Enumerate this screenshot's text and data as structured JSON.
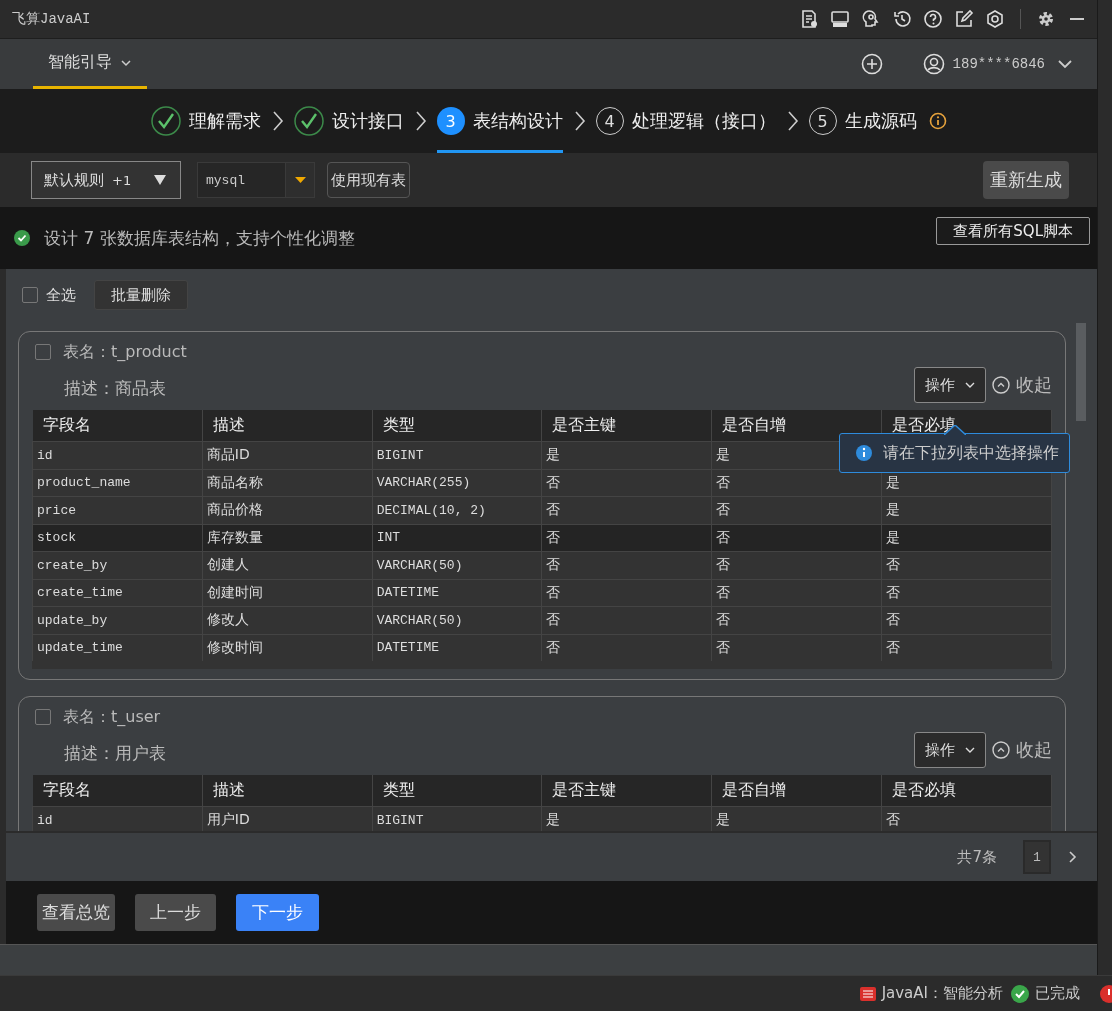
{
  "window": {
    "title": "飞算JavaAI"
  },
  "nav": {
    "tab": {
      "label": "智能引导",
      "selected": true
    },
    "account": "189****6846"
  },
  "steps": [
    {
      "label": "理解需求",
      "done": true,
      "selected": false
    },
    {
      "label": "设计接口",
      "done": true,
      "selected": false
    },
    {
      "number": "3",
      "label": "表结构设计",
      "done": false,
      "selected": true
    },
    {
      "number": "4",
      "label": "处理逻辑（接口）",
      "done": false,
      "selected": false
    },
    {
      "number": "5",
      "label": "生成源码",
      "done": false,
      "selected": false
    }
  ],
  "toolbar": {
    "rule_select": {
      "value": "默认规则",
      "badge": "+1"
    },
    "db_select": {
      "value": "mysql"
    },
    "use_existing_button": "使用现有表",
    "regenerate_button": "重新生成"
  },
  "summary": {
    "text": "设计 7 张数据库表结构，支持个性化调整",
    "sql_button": "查看所有SQL脚本"
  },
  "bulk": {
    "select_all": {
      "label": "全选",
      "checked": false
    },
    "delete_button": "批量删除"
  },
  "tables": [
    {
      "name": "表名：t_product",
      "description": "描述：商品表",
      "checked": false,
      "action_button": "操作",
      "collapse_button": "收起",
      "tooltip": "请在下拉列表中选择操作",
      "columns": [
        "字段名",
        "描述",
        "类型",
        "是否主键",
        "是否自增",
        "是否必填"
      ],
      "rows": [
        {
          "field": "id",
          "desc": "商品ID",
          "type": "BIGINT",
          "pk": "是",
          "auto": "是",
          "highlighted": false
        },
        {
          "field": "product_name",
          "desc": "商品名称",
          "type": "VARCHAR(255)",
          "pk": "否",
          "auto": "否",
          "required": "是",
          "highlighted": false
        },
        {
          "field": "price",
          "desc": "商品价格",
          "type": "DECIMAL(10, 2)",
          "pk": "否",
          "auto": "否",
          "required": "是",
          "highlighted": false
        },
        {
          "field": "stock",
          "desc": "库存数量",
          "type": "INT",
          "pk": "否",
          "auto": "否",
          "required": "是",
          "highlighted": true
        },
        {
          "field": "create_by",
          "desc": "创建人",
          "type": "VARCHAR(50)",
          "pk": "否",
          "auto": "否",
          "required": "否",
          "highlighted": false
        },
        {
          "field": "create_time",
          "desc": "创建时间",
          "type": "DATETIME",
          "pk": "否",
          "auto": "否",
          "required": "否",
          "highlighted": false
        },
        {
          "field": "update_by",
          "desc": "修改人",
          "type": "VARCHAR(50)",
          "pk": "否",
          "auto": "否",
          "required": "否",
          "highlighted": false
        },
        {
          "field": "update_time",
          "desc": "修改时间",
          "type": "DATETIME",
          "pk": "否",
          "auto": "否",
          "required": "否",
          "highlighted": false
        }
      ]
    },
    {
      "name": "表名：t_user",
      "description": "描述：用户表",
      "checked": false,
      "action_button": "操作",
      "collapse_button": "收起",
      "columns": [
        "字段名",
        "描述",
        "类型",
        "是否主键",
        "是否自增",
        "是否必填"
      ],
      "rows": [
        {
          "field": "id",
          "desc": "用户ID",
          "type": "BIGINT",
          "pk": "是",
          "auto": "是",
          "required": "否",
          "highlighted": false
        }
      ]
    }
  ],
  "pagination": {
    "total": "共7条",
    "pages": [
      {
        "label": "1",
        "selected": true
      }
    ]
  },
  "footer_buttons": [
    {
      "label": "查看总览",
      "kind": "secondary"
    },
    {
      "label": "上一步",
      "kind": "secondary"
    },
    {
      "label": "下一步",
      "kind": "primary"
    }
  ],
  "status_bar": {
    "plugin": "JavaAI：智能分析",
    "status": "已完成"
  }
}
